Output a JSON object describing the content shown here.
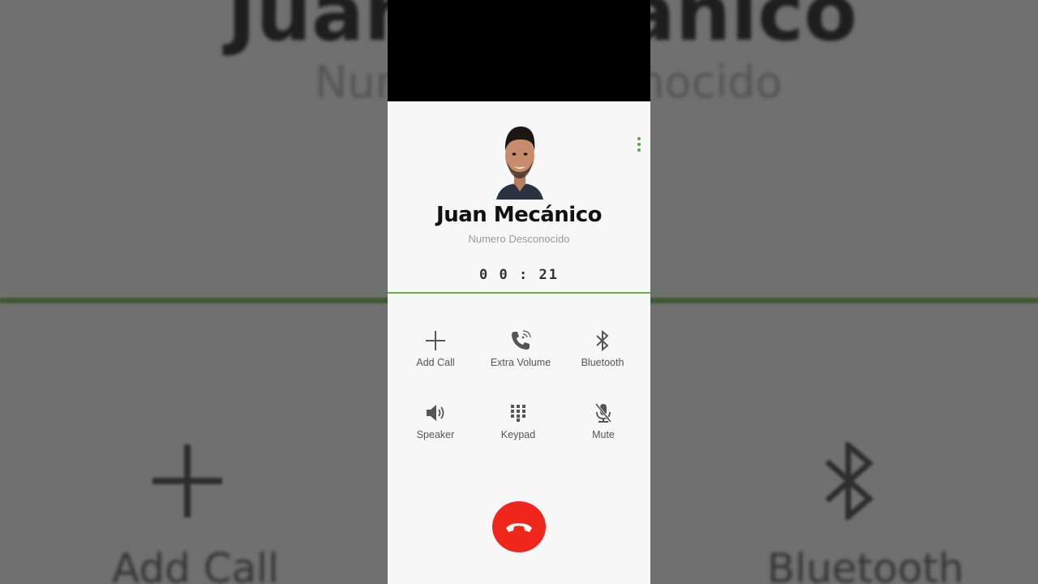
{
  "background_echo": {
    "name": "Juan Mecánico",
    "subtitle": "Numero Desconocido",
    "add_call_label": "Add Call",
    "bluetooth_label": "Bluetooth"
  },
  "call": {
    "contact_name": "Juan Mecánico",
    "number_status": "Numero Desconocido",
    "timer": "0 0 : 21"
  },
  "actions": [
    {
      "label": "Add Call",
      "icon": "plus-icon"
    },
    {
      "label": "Extra Volume",
      "icon": "phone-volume-icon"
    },
    {
      "label": "Bluetooth",
      "icon": "bluetooth-icon"
    },
    {
      "label": "Speaker",
      "icon": "speaker-icon"
    },
    {
      "label": "Keypad",
      "icon": "keypad-icon"
    },
    {
      "label": "Mute",
      "icon": "mic-off-icon"
    }
  ],
  "colors": {
    "accent": "#6cae4f",
    "end_call": "#f0261b",
    "menu_dots": "#5aa843"
  }
}
